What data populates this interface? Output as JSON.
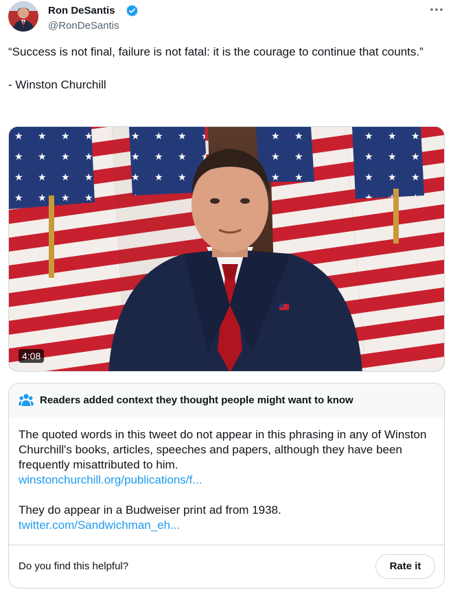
{
  "author": {
    "display_name": "Ron DeSantis",
    "handle": "@RonDeSantis",
    "verified": true,
    "avatar": "avatar-photo"
  },
  "tweet": {
    "text": "“Success is not final, failure is not fatal: it is the courage to continue that counts.”\n\n- Winston Churchill"
  },
  "media": {
    "type": "video",
    "duration": "4:08"
  },
  "community_note": {
    "title": "Readers added context they thought people might want to know",
    "icon": "people-icon",
    "paragraph1": "The quoted words in this tweet do not appear in this phrasing in any of Winston Churchill's books, articles, speeches and papers, although they have been frequently misattributed to him.",
    "link1": "winstonchurchill.org/publications/f...",
    "paragraph2": "They do appear in a Budweiser print ad from 1938.",
    "link2": "twitter.com/Sandwichman_eh...",
    "question": "Do you find this helpful?",
    "rate_label": "Rate it"
  },
  "colors": {
    "accent": "#1d9bf0",
    "text": "#0f1419",
    "secondary": "#536471",
    "border": "#cfd9de"
  }
}
